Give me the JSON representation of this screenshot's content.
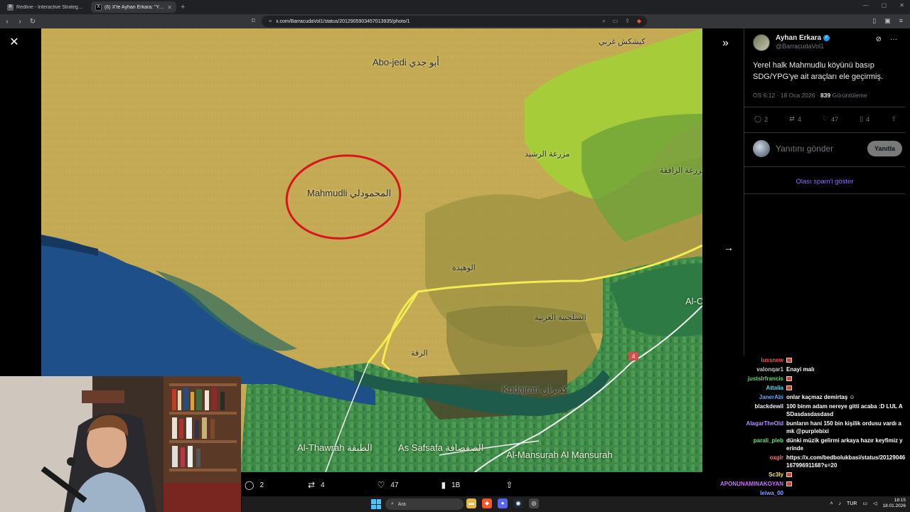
{
  "browser": {
    "tabs": [
      {
        "icon": "R",
        "title": "Redline - Interactive Strategic Map"
      },
      {
        "icon": "X",
        "title": "(6) X'te Ayhan Erkara: \"Yerel halk Mahmudlu köyünü basıp SDG/YPG'ye ait araçları ele geçirmiş.\""
      }
    ],
    "url": "x.com/BarracudaVol1/status/2012905903457013935/photo/1"
  },
  "map": {
    "labels": {
      "abo_jedi": "Abo-jedi أبو جدي",
      "mahmudli": "Mahmudli المحمودلي",
      "kudajran": "Kudajran كديران",
      "al_thawrah": "Al-Thawrah الطبقة",
      "as_safsafa": "As Safsafa الصفصافة",
      "al_mansurah": "Al-Mansurah Al Mansurah",
      "ar_rashid": "مزرعة الرشيد",
      "al_rafiqa": "مزرعة الرافقة",
      "kishkish": "كيشكش غربي",
      "al_wahida": "الوهيدة",
      "salhabiya": "السلحبية الغربية",
      "al_raqqa": "الرقة",
      "al_c": "Al-C",
      "road_4": "4"
    }
  },
  "actions": {
    "replies": "2",
    "reposts": "4",
    "likes": "47",
    "views": "1B"
  },
  "tweet": {
    "author_name": "Ayhan Erkara",
    "author_handle": "@BarracudaVol1",
    "text": "Yerel halk Mahmudlu köyünü basıp SDG/YPG'ye ait araçları ele geçirmiş.",
    "time": "ÖS 6:12 · 18 Oca 2026 · ",
    "views_count": "839",
    "views_label": " Görüntüleme",
    "stats": {
      "replies": "2",
      "reposts": "4",
      "likes": "47",
      "bookmarks": "4"
    },
    "reply_placeholder": "Yanıtını gönder",
    "reply_button": "Yanıtla",
    "spam_link": "Olası spam'i göster"
  },
  "chat": [
    {
      "user": "Iussnew",
      "color": "#ff4f4f",
      "msg": "",
      "emote": true
    },
    {
      "user": "valonqar1",
      "color": "#c8c8c8",
      "msg": "Enayi malı",
      "emote": false
    },
    {
      "user": "justsIrfrancis",
      "color": "#64d66a",
      "msg": "",
      "emote": true
    },
    {
      "user": "Attalia",
      "color": "#58d6e8",
      "msg": "",
      "emote": true
    },
    {
      "user": "JanerAbi",
      "color": "#6aa8ff",
      "msg": "onlar kaçmaz demirtaş ☺",
      "emote": false
    },
    {
      "user": "blackdewil",
      "color": "#f0f0f0",
      "msg": "100 binm adam nereye gitti acaba :D LUL ASDasdasdasdasd",
      "emote": false
    },
    {
      "user": "AlagarTheOld",
      "color": "#b48cff",
      "msg": "bunların hani 150 bin kişilik ordusu vardı amk @purplebixi",
      "emote": false
    },
    {
      "user": "parali_pleb",
      "color": "#6ee06e",
      "msg": "dünki müzik gelirmi arkaya hazır keyfimiz yerinde",
      "emote": false
    },
    {
      "user": "oxglr",
      "color": "#ff7a5a",
      "msg": "https://x.com/bedbolukbasi/status/2012904616799691168?s=20",
      "emote": false
    },
    {
      "user": "Sc3ly",
      "color": "#f5e66a",
      "msg": "",
      "emote": true
    },
    {
      "user": "APONUNAMINAKOYAN",
      "color": "#c870ff",
      "msg": "",
      "emote": true
    },
    {
      "user": "leiwa_00",
      "color": "#8aa0ff",
      "msg": "",
      "emote": false
    }
  ],
  "taskbar": {
    "search": "Ara",
    "lang": "TUR",
    "time": "18:15",
    "date": "18.01.2026"
  }
}
